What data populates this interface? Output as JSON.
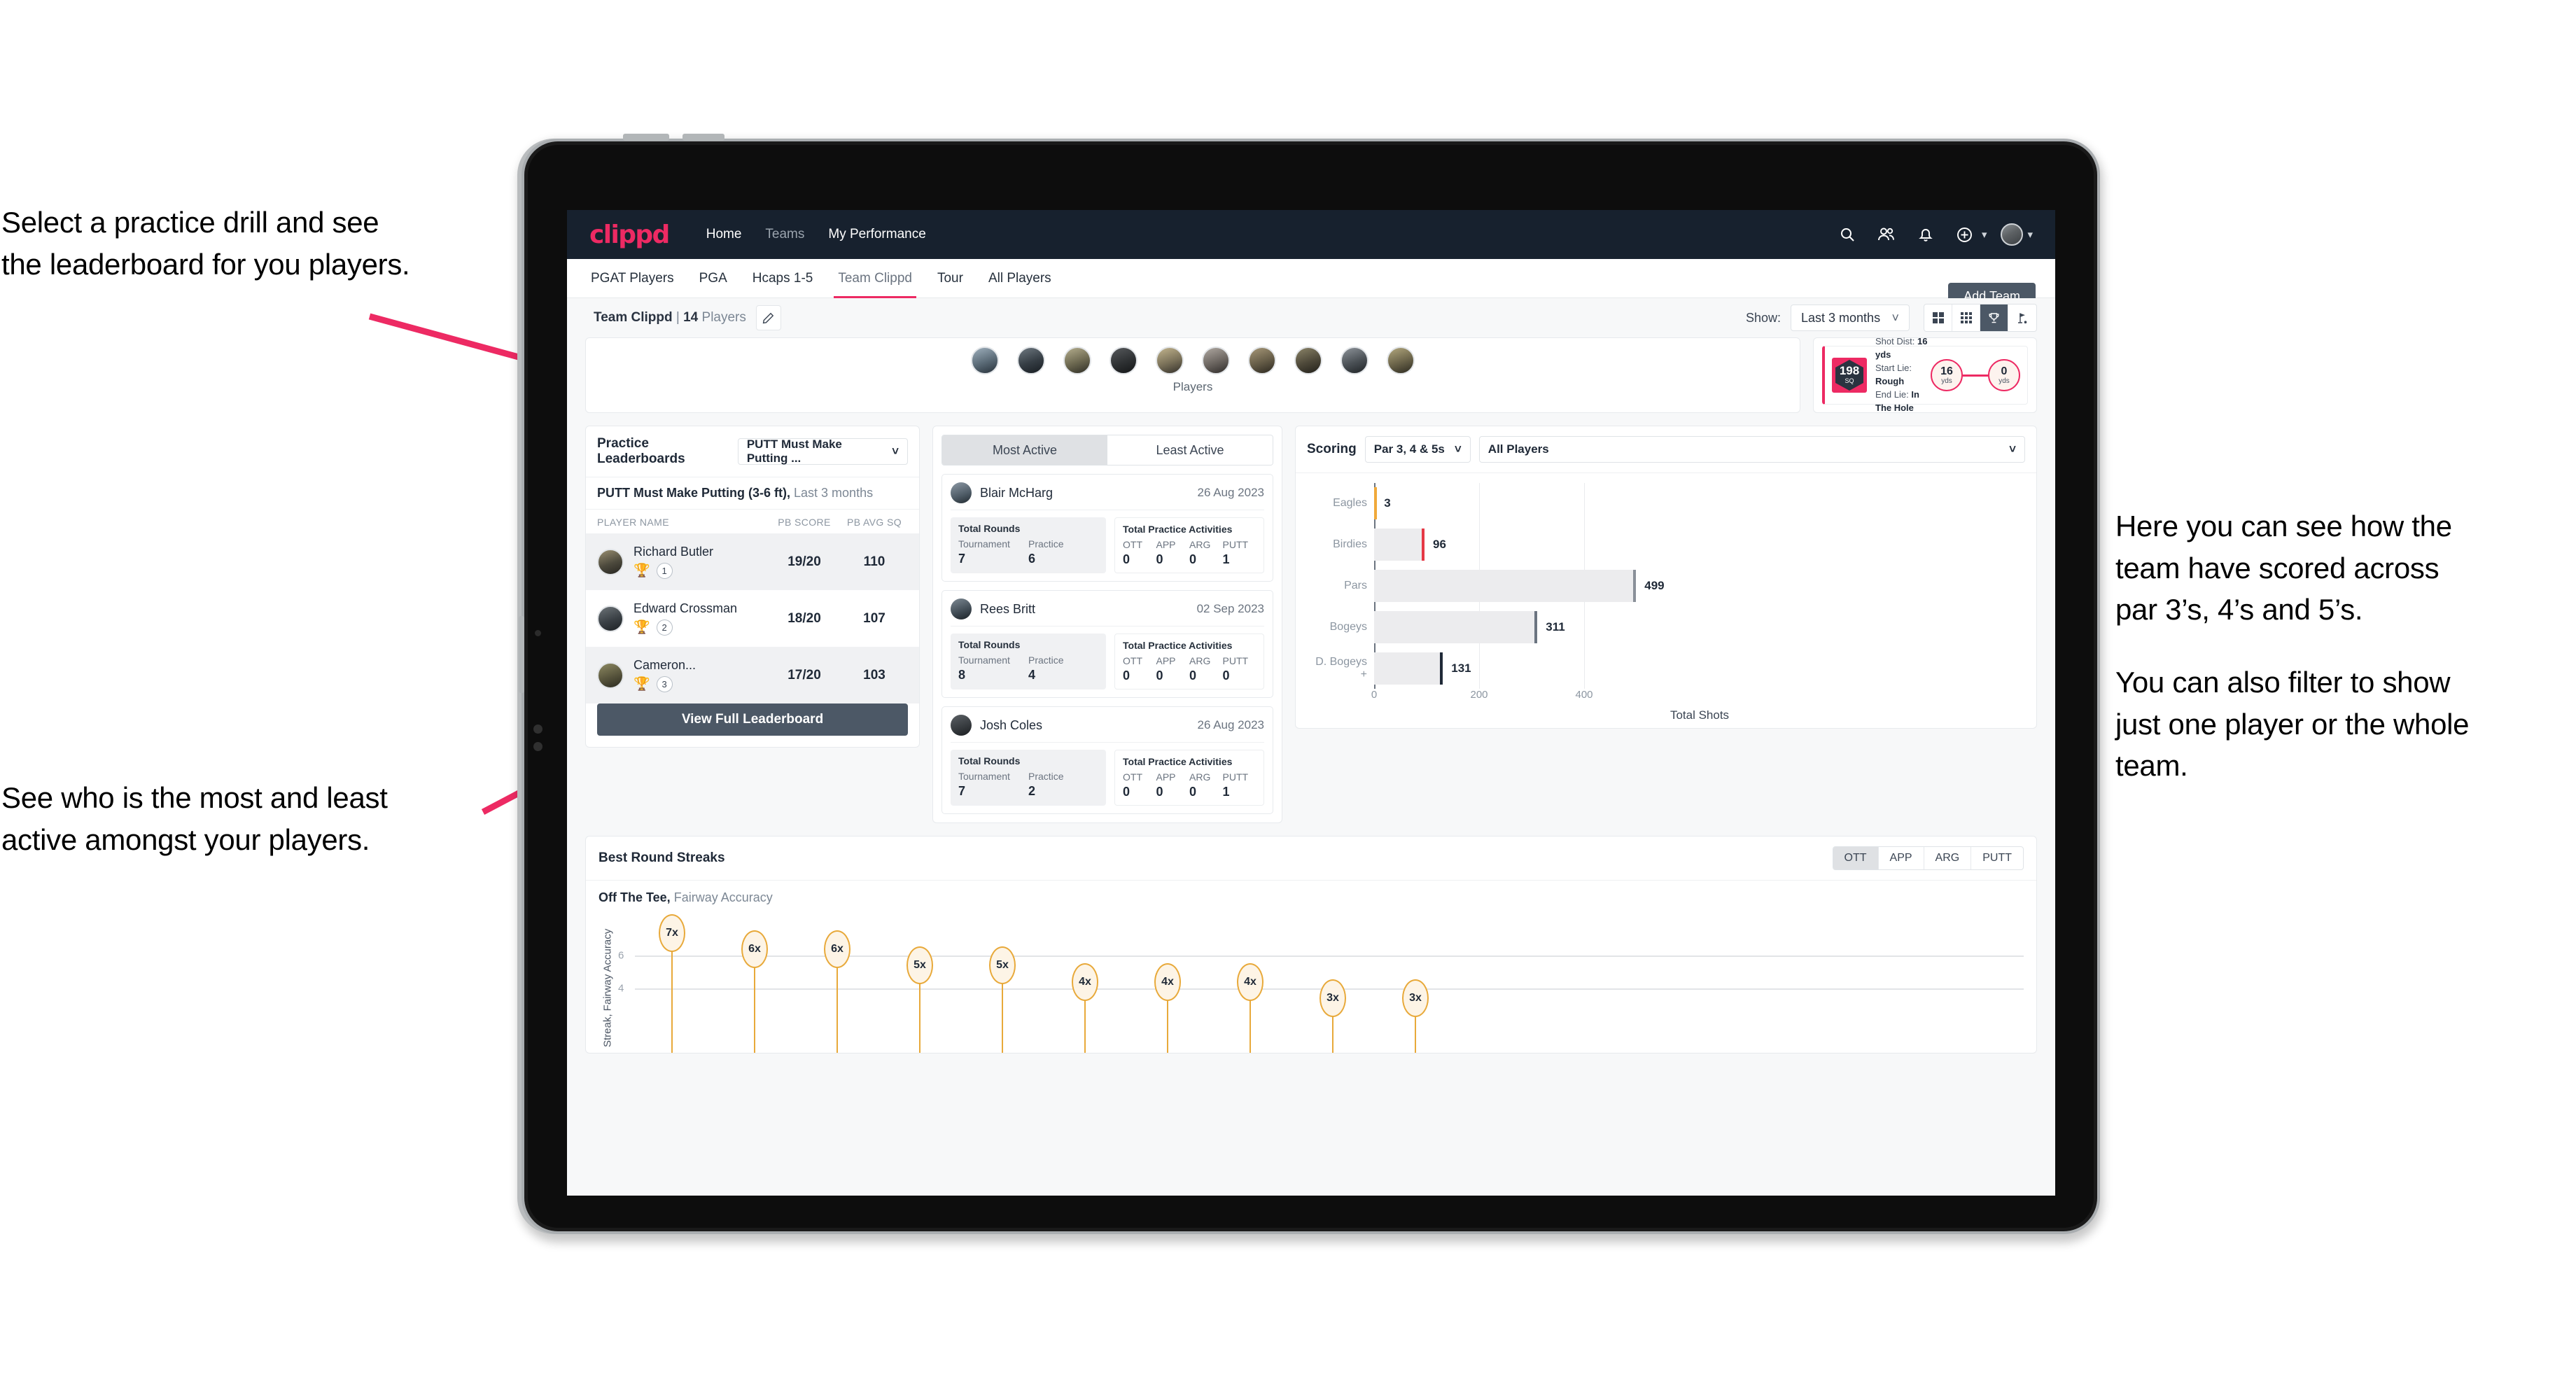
{
  "annotations": {
    "top_left": [
      "Select a practice drill and see",
      "the leaderboard for you players."
    ],
    "bottom_left": [
      "See who is the most and least",
      "active amongst your players."
    ],
    "right_1": [
      "Here you can see how the",
      "team have scored across",
      "par 3’s, 4’s and 5’s."
    ],
    "right_2": [
      "You can also filter to show",
      "just one player or the whole",
      "team."
    ]
  },
  "topnav": {
    "logo": "clippd",
    "links": [
      {
        "label": "Home",
        "dim": false
      },
      {
        "label": "Teams",
        "dim": true
      },
      {
        "label": "My Performance",
        "dim": false
      }
    ],
    "icons": [
      "search-icon",
      "people-icon",
      "bell-icon",
      "plus-circle-icon",
      "avatar"
    ]
  },
  "tabs": [
    {
      "label": "PGAT Players",
      "active": false
    },
    {
      "label": "PGA",
      "active": false
    },
    {
      "label": "Hcaps 1-5",
      "active": false
    },
    {
      "label": "Team Clippd",
      "active": true
    },
    {
      "label": "Tour",
      "active": false
    },
    {
      "label": "All Players",
      "active": false
    }
  ],
  "add_team_button": "Add Team",
  "team_bar": {
    "team_name": "Team Clippd",
    "divider": "|",
    "player_count": "14",
    "players_word": "Players",
    "edit_icon": "pencil-icon",
    "show_label": "Show:",
    "period_value": "Last 3 months",
    "view_modes": [
      "grid-large-icon",
      "grid-small-icon",
      "trophy-icon",
      "flag-icon"
    ],
    "active_view_mode": 2
  },
  "players_strip": {
    "label": "Players",
    "avatar_count": 10
  },
  "shot_card": {
    "badge_value": "198",
    "badge_unit": "SQ",
    "lines": [
      {
        "label": "Shot Dist:",
        "value": "16 yds"
      },
      {
        "label": "Start Lie:",
        "value": "Rough"
      },
      {
        "label": "End Lie:",
        "value": "In The Hole"
      }
    ],
    "start_dist": "16",
    "start_unit": "yds",
    "end_dist": "0",
    "end_unit": "yds"
  },
  "leaderboard": {
    "title": "Practice Leaderboards",
    "drill_select": "PUTT Must Make Putting ...",
    "subtitle_bold": "PUTT Must Make Putting (3-6 ft),",
    "subtitle_light": "Last 3 months",
    "columns": [
      "PLAYER NAME",
      "PB SCORE",
      "PB AVG SQ"
    ],
    "rows": [
      {
        "name": "Richard Butler",
        "rank": "1",
        "trophy": "gold",
        "score": "19/20",
        "avg": "110"
      },
      {
        "name": "Edward Crossman",
        "rank": "2",
        "trophy": "silver",
        "score": "18/20",
        "avg": "107"
      },
      {
        "name": "Cameron...",
        "rank": "3",
        "trophy": "bronze",
        "score": "17/20",
        "avg": "103"
      }
    ],
    "button": "View Full Leaderboard"
  },
  "activity": {
    "tabs": [
      {
        "label": "Most Active",
        "active": true
      },
      {
        "label": "Least Active",
        "active": false
      }
    ],
    "rounds_heading": "Total Rounds",
    "rounds_keys": [
      "Tournament",
      "Practice"
    ],
    "acts_heading": "Total Practice Activities",
    "acts_keys": [
      "OTT",
      "APP",
      "ARG",
      "PUTT"
    ],
    "items": [
      {
        "name": "Blair McHarg",
        "date": "26 Aug 2023",
        "rounds": [
          "7",
          "6"
        ],
        "acts": [
          "0",
          "0",
          "0",
          "1"
        ]
      },
      {
        "name": "Rees Britt",
        "date": "02 Sep 2023",
        "rounds": [
          "8",
          "4"
        ],
        "acts": [
          "0",
          "0",
          "0",
          "0"
        ]
      },
      {
        "name": "Josh Coles",
        "date": "26 Aug 2023",
        "rounds": [
          "7",
          "2"
        ],
        "acts": [
          "0",
          "0",
          "0",
          "1"
        ]
      }
    ]
  },
  "scoring": {
    "title": "Scoring",
    "par_select": "Par 3, 4 & 5s",
    "player_select": "All Players"
  },
  "streaks": {
    "title": "Best Round Streaks",
    "segments": [
      {
        "label": "OTT",
        "active": true
      },
      {
        "label": "APP",
        "active": false
      },
      {
        "label": "ARG",
        "active": false
      },
      {
        "label": "PUTT",
        "active": false
      }
    ],
    "sub_bold": "Off The Tee,",
    "sub_light": "Fairway Accuracy"
  },
  "colors": {
    "brand_pink": "#ed2a63",
    "nav_dark": "#17212e",
    "slate": "#4c5866",
    "gold": "#e8a93a"
  },
  "chart_data": [
    {
      "type": "bar",
      "orientation": "horizontal",
      "title": "Scoring",
      "categories": [
        "Eagles",
        "Birdies",
        "Pars",
        "Bogeys",
        "D. Bogeys +"
      ],
      "values": [
        3,
        96,
        499,
        311,
        131
      ],
      "cap_colors": [
        "#f0a93a",
        "#e53946",
        "#8a9099",
        "#6b7480",
        "#1f2937"
      ],
      "xlabel": "Total Shots",
      "ylabel": "",
      "xticks": [
        0,
        200,
        400
      ],
      "xlim": [
        0,
        560
      ],
      "grid": true,
      "legend": "none"
    },
    {
      "type": "bar",
      "orientation": "vertical-lollipop",
      "title": "Off The Tee, Fairway Accuracy",
      "categories": [
        "1",
        "2",
        "3",
        "4",
        "5",
        "6",
        "7",
        "8",
        "9",
        "10"
      ],
      "values": [
        7,
        6,
        6,
        5,
        5,
        4,
        4,
        4,
        3,
        3
      ],
      "labels": [
        "7x",
        "6x",
        "6x",
        "5x",
        "5x",
        "4x",
        "4x",
        "4x",
        "3x",
        "3x"
      ],
      "ylabel": "Streak, Fairway Accuracy",
      "yticks": [
        4,
        6
      ],
      "ylim": [
        0,
        8
      ],
      "grid": true,
      "legend": "none"
    }
  ]
}
